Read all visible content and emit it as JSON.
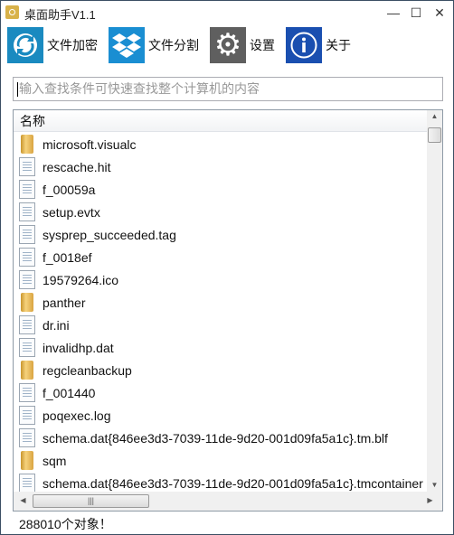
{
  "window": {
    "title": "桌面助手V1.1",
    "minimize": "—",
    "maximize": "☐",
    "close": "✕"
  },
  "toolbar": [
    {
      "label": "文件加密",
      "icon": "encrypt-sync-icon",
      "color": "#1a8ac0"
    },
    {
      "label": "文件分割",
      "icon": "dropbox-box-icon",
      "color": "#1a8ed2"
    },
    {
      "label": "设置",
      "icon": "gear-icon",
      "color": "#5f5f5f"
    },
    {
      "label": "关于",
      "icon": "info-icon",
      "color": "#1a4fb0"
    }
  ],
  "search": {
    "placeholder": "输入查找条件可快速查找整个计算机的内容",
    "value": ""
  },
  "list": {
    "header": "名称",
    "rows": [
      {
        "name": "microsoft.visualc",
        "type": "folder"
      },
      {
        "name": "rescache.hit",
        "type": "file"
      },
      {
        "name": "f_00059a",
        "type": "file"
      },
      {
        "name": "setup.evtx",
        "type": "file"
      },
      {
        "name": "sysprep_succeeded.tag",
        "type": "file"
      },
      {
        "name": "f_0018ef",
        "type": "file"
      },
      {
        "name": "19579264.ico",
        "type": "file"
      },
      {
        "name": "panther",
        "type": "folder"
      },
      {
        "name": "dr.ini",
        "type": "file"
      },
      {
        "name": "invalidhp.dat",
        "type": "file"
      },
      {
        "name": "regcleanbackup",
        "type": "folder"
      },
      {
        "name": "f_001440",
        "type": "file"
      },
      {
        "name": "poqexec.log",
        "type": "file"
      },
      {
        "name": "schema.dat{846ee3d3-7039-11de-9d20-001d09fa5a1c}.tm.blf",
        "type": "file"
      },
      {
        "name": "sqm",
        "type": "folder"
      },
      {
        "name": "schema.dat{846ee3d3-7039-11de-9d20-001d09fa5a1c}.tmcontainer",
        "type": "file"
      }
    ]
  },
  "status": "288010个对象！"
}
